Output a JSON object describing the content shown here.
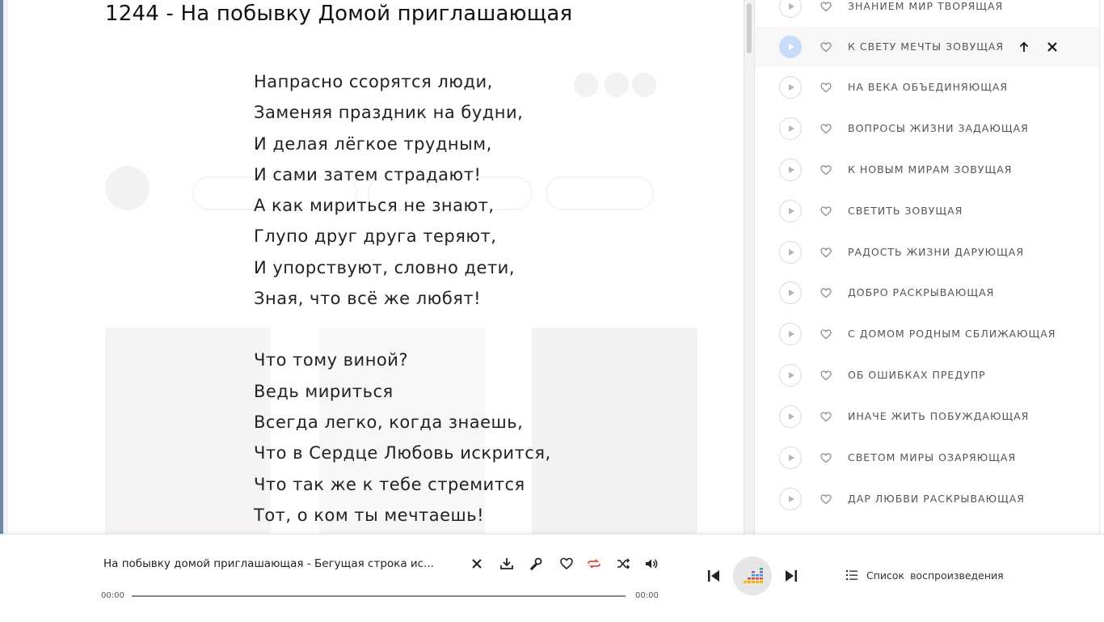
{
  "song": {
    "title": "1244 - На побывку Домой приглашающая",
    "stanzas": [
      [
        "Напрасно ссорятся люди,",
        "Заменяя праздник на будни,",
        "И делая лёгкое трудным,",
        "И сами затем страдают!",
        "А как мириться не знают,",
        "Глупо друг друга теряют,",
        "И упорствуют, словно дети,",
        "Зная, что всё же любят!"
      ],
      [
        "Что тому виной?",
        "Ведь мириться",
        "Всегда легко, когда знаешь,",
        "Что в Сердце Любовь искрится,",
        "Что так же к тебе стремится",
        "Тот, о ком ты мечтаешь!"
      ]
    ]
  },
  "playlist": {
    "items": [
      {
        "title": "ЗНАНИЕМ МИР ТВОРЯЩАЯ",
        "active": false
      },
      {
        "title": "К СВЕТУ МЕЧТЫ ЗОВУЩАЯ",
        "active": true
      },
      {
        "title": "НА ВЕКА ОБЪЕДИНЯЮЩАЯ",
        "active": false
      },
      {
        "title": "ВОПРОСЫ ЖИЗНИ ЗАДАЮЩАЯ",
        "active": false
      },
      {
        "title": "К НОВЫМ МИРАМ ЗОВУЩАЯ",
        "active": false
      },
      {
        "title": "СВЕТИТЬ ЗОВУЩАЯ",
        "active": false
      },
      {
        "title": "РАДОСТЬ ЖИЗНИ ДАРУЮЩАЯ",
        "active": false
      },
      {
        "title": "ДОБРО РАСКРЫВАЮЩАЯ",
        "active": false
      },
      {
        "title": "С ДОМОМ РОДНЫМ СБЛИЖАЮЩАЯ",
        "active": false
      },
      {
        "title": "ОБ ОШИБКАХ ПРЕДУПР",
        "active": false
      },
      {
        "title": "ИНАЧЕ ЖИТЬ ПОБУЖДАЮЩАЯ",
        "active": false
      },
      {
        "title": "СВЕТОМ МИРЫ ОЗАРЯЮЩАЯ",
        "active": false
      },
      {
        "title": "ДАР ЛЮБВИ РАСКРЫВАЮЩАЯ",
        "active": false
      }
    ]
  },
  "player": {
    "track_name": "На побывку домой приглашающая  - Бегущая строка ис...",
    "time_current": "00:00",
    "time_total": "00:00",
    "progress": 0,
    "queue_label": "Список воспроизведения",
    "icons": [
      "close-icon",
      "download-icon",
      "lyrics-mic-icon",
      "heart-icon",
      "repeat-icon",
      "shuffle-icon",
      "volume-icon",
      "previous-icon",
      "equalizer-icon",
      "next-icon",
      "list-icon"
    ],
    "accent_color": "#e3473b"
  }
}
